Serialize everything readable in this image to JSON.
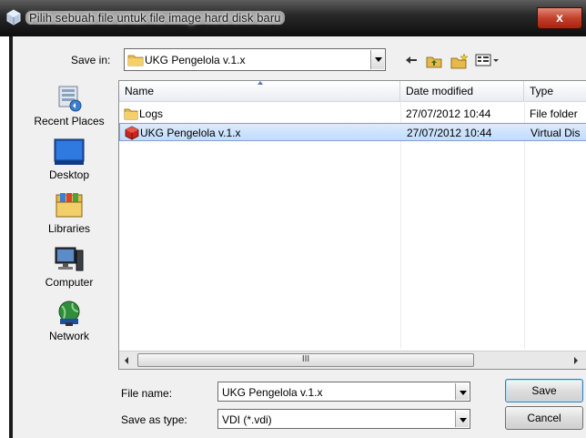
{
  "window": {
    "title": "Pilih sebuah file untuk file image hard disk baru",
    "close_label": "x"
  },
  "toolbar": {
    "save_in_label": "Save in:",
    "save_in_value": "UKG Pengelola v.1.x",
    "back_icon": "back-arrow-icon",
    "up_icon": "up-folder-icon",
    "new_folder_icon": "new-folder-icon",
    "views_icon": "views-menu-icon"
  },
  "places": [
    {
      "label": "Recent Places",
      "icon": "recent-places-icon"
    },
    {
      "label": "Desktop",
      "icon": "desktop-icon"
    },
    {
      "label": "Libraries",
      "icon": "libraries-icon"
    },
    {
      "label": "Computer",
      "icon": "computer-icon"
    },
    {
      "label": "Network",
      "icon": "network-icon"
    }
  ],
  "list": {
    "columns": [
      "Name",
      "Date modified",
      "Type"
    ],
    "rows": [
      {
        "name": "Logs",
        "date": "27/07/2012 10:44",
        "type": "File folder",
        "icon": "folder-icon",
        "selected": false
      },
      {
        "name": "UKG Pengelola v.1.x",
        "date": "27/07/2012 10:44",
        "type": "Virtual Dis",
        "icon": "virtualbox-disk-icon",
        "selected": true
      }
    ],
    "scroll_thumb_label": "III"
  },
  "form": {
    "file_name_label": "File name:",
    "file_name_value": "UKG Pengelola v.1.x",
    "save_type_label": "Save as type:",
    "save_type_value": "VDI (*.vdi)",
    "save_button": "Save",
    "cancel_button": "Cancel"
  }
}
